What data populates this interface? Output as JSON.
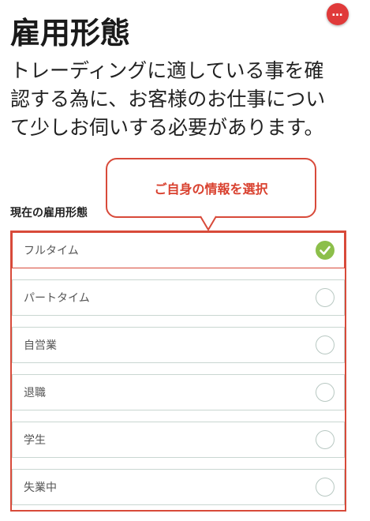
{
  "header": {
    "more_button_label": "…",
    "title": "雇用形態",
    "description": "トレーディングに適している事を確認する為に、お客様のお仕事について少しお伺いする必要があります。"
  },
  "callout": {
    "text": "ご自身の情報を選択"
  },
  "employment": {
    "section_label": "現在の雇用形態",
    "options": [
      {
        "label": "フルタイム",
        "selected": true
      },
      {
        "label": "パートタイム",
        "selected": false
      },
      {
        "label": "自営業",
        "selected": false
      },
      {
        "label": "退職",
        "selected": false
      },
      {
        "label": "学生",
        "selected": false
      },
      {
        "label": "失業中",
        "selected": false
      }
    ]
  },
  "colors": {
    "accent_red": "#d84a3a",
    "check_green": "#8cbf4a",
    "more_button_red": "#e03a3a"
  }
}
